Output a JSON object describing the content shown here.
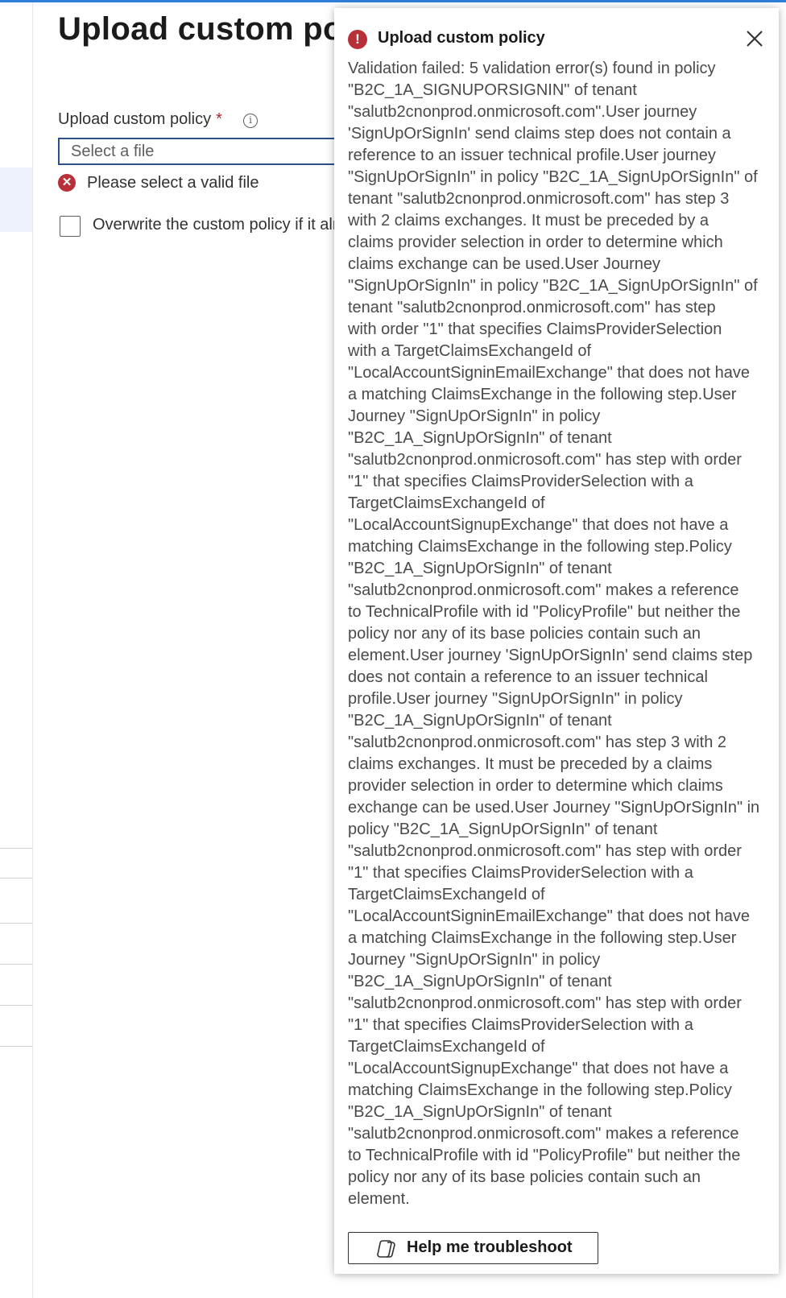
{
  "page": {
    "title": "Upload custom policy",
    "field_label": "Upload custom policy",
    "required_marker": "*",
    "info_glyph": "i",
    "file_placeholder": "Select a file",
    "error_glyph": "✕",
    "error_text": "Please select a valid file",
    "overwrite_label": "Overwrite the custom policy if it already exists"
  },
  "notification": {
    "glyph": "!",
    "title": "Upload custom policy",
    "message_lines": [
      "Validation failed: 5 validation error(s) found in policy",
      "\"B2C_1A_SIGNUPORSIGNIN\" of tenant",
      "\"salutb2cnonprod.onmicrosoft.com\".User journey",
      "'SignUpOrSignIn' send claims step does not contain a",
      "reference to an issuer technical profile.User journey",
      "\"SignUpOrSignIn\" in policy \"B2C_1A_SignUpOrSignIn\" of",
      "tenant \"salutb2cnonprod.onmicrosoft.com\" has step 3",
      "with 2 claims exchanges. It must be preceded by a",
      "claims provider selection in order to determine which",
      "claims exchange can be used.User Journey",
      "\"SignUpOrSignIn\" in policy \"B2C_1A_SignUpOrSignIn\" of",
      "tenant \"salutb2cnonprod.onmicrosoft.com\" has step",
      "with order \"1\" that specifies ClaimsProviderSelection",
      "with a TargetClaimsExchangeId of",
      "\"LocalAccountSigninEmailExchange\" that does not have",
      "a matching ClaimsExchange in the following step.User",
      "Journey \"SignUpOrSignIn\" in policy",
      "\"B2C_1A_SignUpOrSignIn\" of tenant",
      "\"salutb2cnonprod.onmicrosoft.com\" has step with order",
      "\"1\" that specifies ClaimsProviderSelection with a",
      "TargetClaimsExchangeId of",
      "\"LocalAccountSignupExchange\" that does not have a",
      "matching ClaimsExchange in the following step.Policy",
      "\"B2C_1A_SignUpOrSignIn\" of tenant",
      "\"salutb2cnonprod.onmicrosoft.com\" makes a reference",
      "to TechnicalProfile with id \"PolicyProfile\" but neither the",
      "policy nor any of its base policies contain such an",
      "element.User journey 'SignUpOrSignIn' send claims step",
      "does not contain a reference to an issuer technical",
      "profile.User journey \"SignUpOrSignIn\" in policy",
      "\"B2C_1A_SignUpOrSignIn\" of tenant",
      "\"salutb2cnonprod.onmicrosoft.com\" has step 3 with 2",
      "claims exchanges. It must be preceded by a claims",
      "provider selection in order to determine which claims",
      "exchange can be used.User Journey \"SignUpOrSignIn\" in",
      "policy \"B2C_1A_SignUpOrSignIn\" of tenant",
      "\"salutb2cnonprod.onmicrosoft.com\" has step with order",
      "\"1\" that specifies ClaimsProviderSelection with a",
      "TargetClaimsExchangeId of",
      "\"LocalAccountSigninEmailExchange\" that does not have",
      "a matching ClaimsExchange in the following step.User",
      "Journey \"SignUpOrSignIn\" in policy",
      "\"B2C_1A_SignUpOrSignIn\" of tenant",
      "\"salutb2cnonprod.onmicrosoft.com\" has step with order",
      "\"1\" that specifies ClaimsProviderSelection with a",
      "TargetClaimsExchangeId of",
      "\"LocalAccountSignupExchange\" that does not have a",
      "matching ClaimsExchange in the following step.Policy",
      "\"B2C_1A_SignUpOrSignIn\" of tenant",
      "\"salutb2cnonprod.onmicrosoft.com\" makes a reference",
      "to TechnicalProfile with id \"PolicyProfile\" but neither the",
      "policy nor any of its base policies contain such an",
      "element."
    ],
    "help_button_label": "Help me troubleshoot"
  },
  "icons": {
    "info": "info-icon",
    "error": "error-circle-icon",
    "close": "close-icon",
    "copilot": "copilot-icon"
  },
  "colors": {
    "accent": "#2d7fd8",
    "error": "#b83138",
    "input_border": "#2f4f8a"
  }
}
